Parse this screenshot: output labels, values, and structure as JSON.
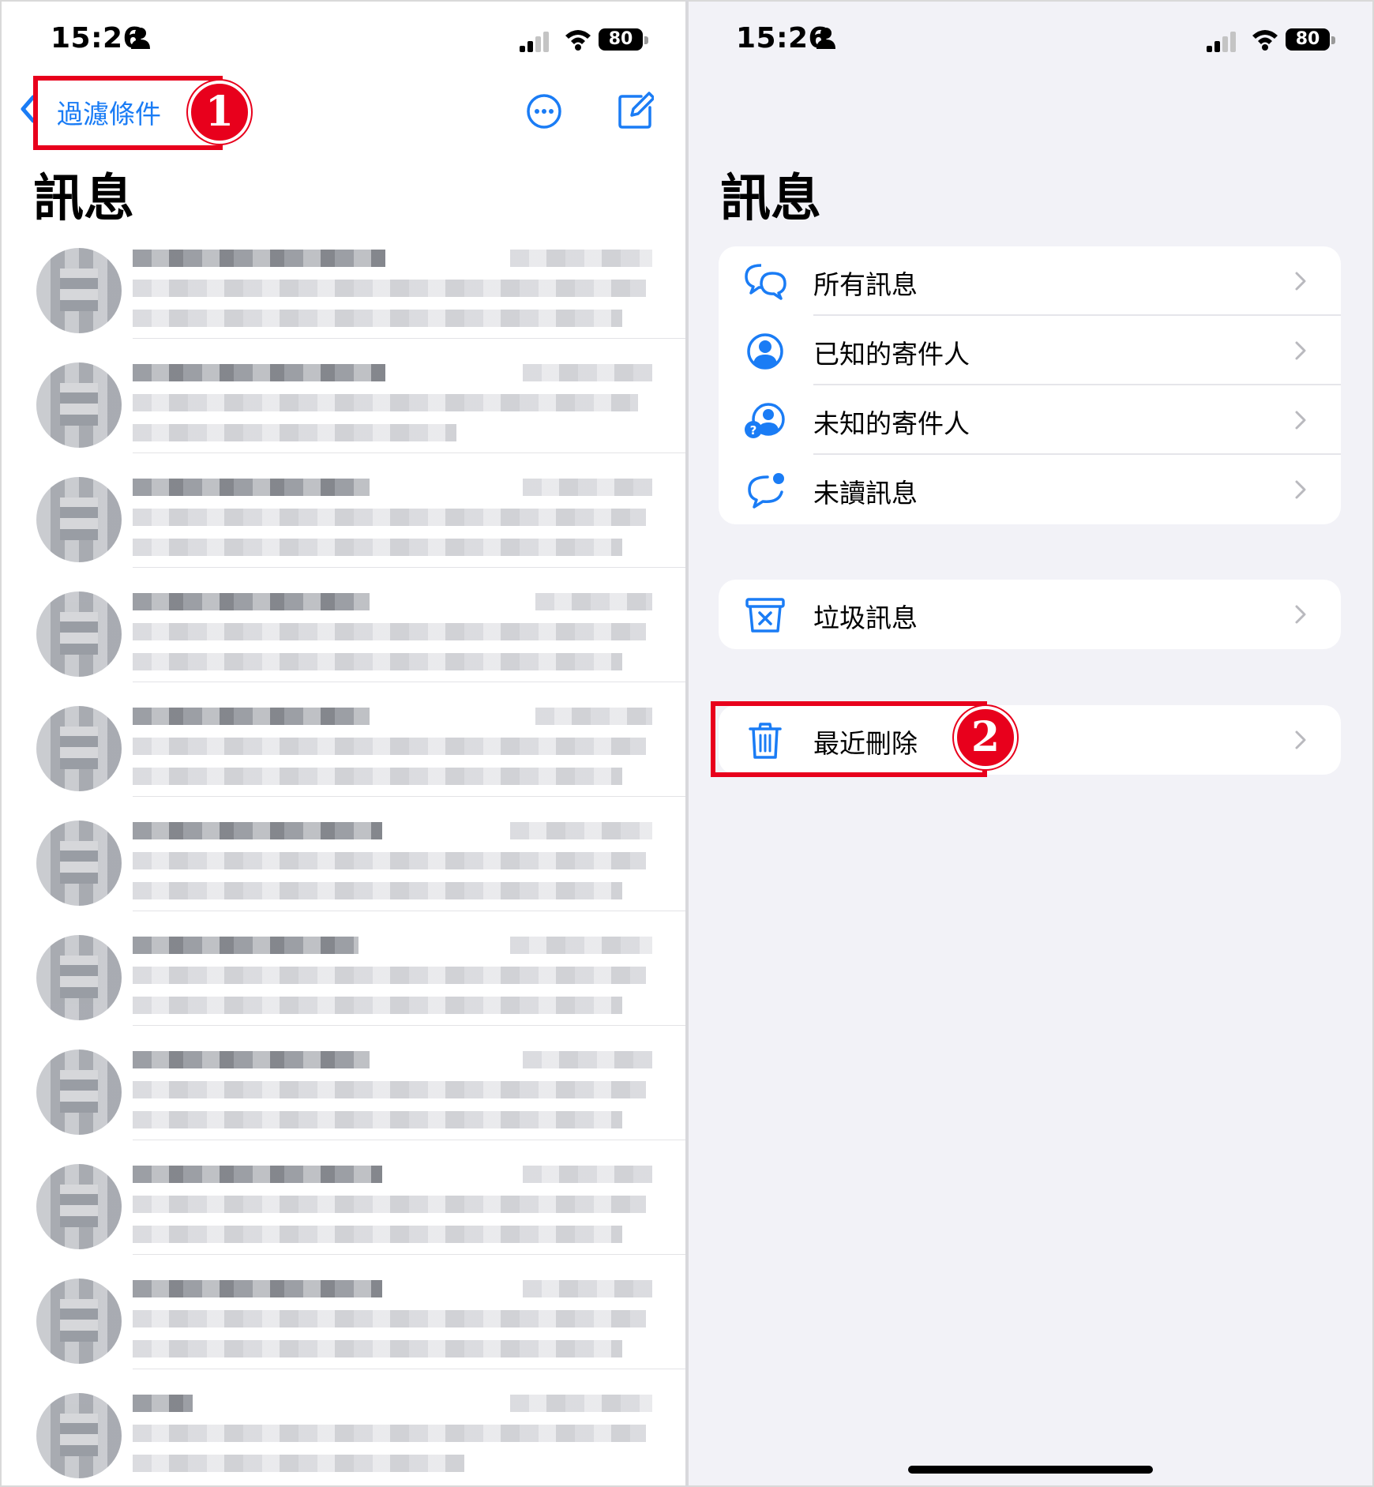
{
  "left_screen": {
    "status_bar": {
      "time": "15:26",
      "battery": "80"
    },
    "nav": {
      "back_label": "過濾條件"
    },
    "title": "訊息",
    "annotation_number": "1"
  },
  "right_screen": {
    "status_bar": {
      "time": "15:26",
      "battery": "80"
    },
    "title": "訊息",
    "filter_group": [
      {
        "label": "所有訊息",
        "icon": "chat-bubbles-icon"
      },
      {
        "label": "已知的寄件人",
        "icon": "person-circle-icon"
      },
      {
        "label": "未知的寄件人",
        "icon": "person-question-icon"
      },
      {
        "label": "未讀訊息",
        "icon": "chat-bubble-dot-icon"
      }
    ],
    "junk_group": [
      {
        "label": "垃圾訊息",
        "icon": "junk-bin-icon"
      }
    ],
    "deleted_group": [
      {
        "label": "最近刪除",
        "icon": "trash-icon"
      }
    ],
    "annotation_number": "2"
  },
  "colors": {
    "accent": "#1a7cf5",
    "annotation": "#e8001c",
    "grouped_background": "#f2f2f7"
  }
}
